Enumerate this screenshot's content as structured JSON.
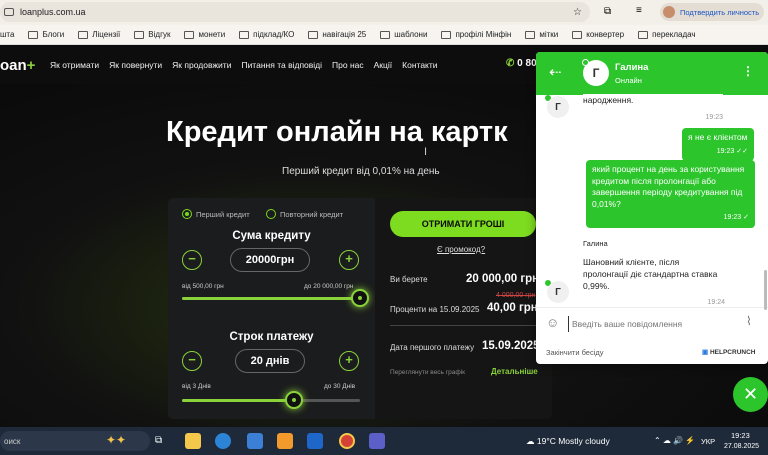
{
  "browser": {
    "url": "loanplus.com.ua",
    "profile_label": "Подтвердить личность",
    "bookmarks": [
      "шта",
      "Блоги",
      "Ліцензії",
      "Відгук",
      "монети",
      "підклад/КО",
      "навігація 25",
      "шаблони",
      "профілі Мінфін",
      "мітки",
      "конвертер",
      "перекладач"
    ]
  },
  "site": {
    "logo": "oan",
    "nav": [
      "Як отримати",
      "Як повернути",
      "Як продовжити",
      "Питання та відповіді",
      "Про нас",
      "Акції",
      "Контакти"
    ],
    "phone": "0 80",
    "title": "Кредит онлайн на картк",
    "subtitle": "Перший кредит від 0,01% на день"
  },
  "calculator": {
    "tab_first": "Перший кредит",
    "tab_repeat": "Повторний кредит",
    "amount_title": "Сума кредиту",
    "amount_value": "20000грн",
    "amount_min": "від 500,00 грн",
    "amount_max": "до 20 000,00 грн",
    "amount_fraction": 1.0,
    "term_title": "Строк платежу",
    "term_value": "20 днів",
    "term_min": "від 3 Днів",
    "term_max": "до 30 Днів",
    "term_fraction": 0.63,
    "minus": "−",
    "plus": "+"
  },
  "summary": {
    "cta": "ОТРИМАТИ ГРОШІ",
    "promo": "Є промокод?",
    "take_label": "Ви берете",
    "take_value": "20 000,00 грн",
    "old_interest": "4 000,00 грн",
    "interest_label": "Проценти на 15.09.2025",
    "interest_value": "40,00 грн",
    "date_label": "Дата першого платежу",
    "date_value": "15.09.2025",
    "schedule_label": "Переглянути весь графік",
    "details_label": "Детальніше"
  },
  "chat": {
    "agent_initial": "Г",
    "agent_name": "Галина",
    "status": "Онлайн",
    "messages": [
      {
        "from": "agent",
        "text": "народження.",
        "time": "19:23"
      },
      {
        "from": "user",
        "text": "я не є клієнтом",
        "time": "19:23"
      },
      {
        "from": "user",
        "text": "який процент на день за користування кредитом після пролонгації або завершення періоду кредитування під 0,01%?",
        "time": "19:23"
      },
      {
        "from": "agent",
        "name": "Галина",
        "text": "Шановний клієнте, після пролонгації діє стандартна ставка 0,99%.",
        "time": "19:24"
      }
    ],
    "input_placeholder": "Введіть ваше повідомлення",
    "end_label": "Закінчити бесіду",
    "brand": "HELPCRUNCH"
  },
  "taskbar": {
    "search": "оиск",
    "weather": "19°C  Mostly cloudy",
    "lang": "УКР",
    "time": "19:23",
    "date": "27.08.2025"
  },
  "colors": {
    "accent": "#7ddc1f",
    "chat": "#2cc52c"
  }
}
